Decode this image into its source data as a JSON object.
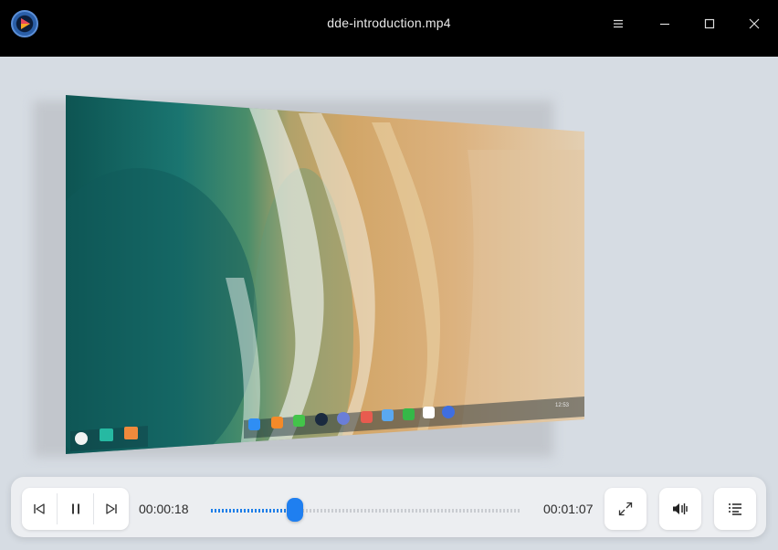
{
  "window": {
    "title": "dde-introduction.mp4",
    "icons": [
      "app-logo",
      "menu-icon",
      "minimize-icon",
      "maximize-icon",
      "close-icon"
    ]
  },
  "video": {
    "content": "aerial beach waves desktop preview",
    "dock_time": "12:53"
  },
  "player": {
    "current_time": "00:00:18",
    "total_time": "00:01:07",
    "progress_fraction": 0.27,
    "accent": "#1f7ff0",
    "icons": [
      "previous-icon",
      "pause-icon",
      "next-icon",
      "fullscreen-icon",
      "volume-icon",
      "playlist-icon"
    ]
  }
}
